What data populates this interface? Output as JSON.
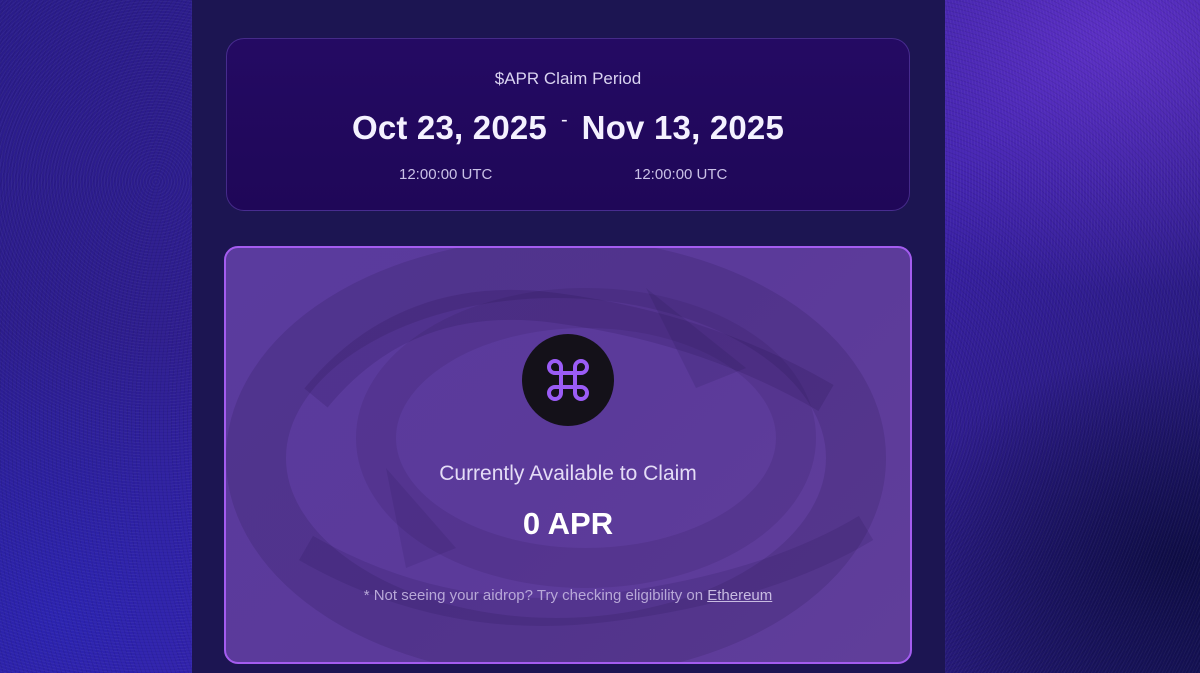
{
  "claim_period": {
    "title": "$APR Claim Period",
    "start_date": "Oct 23, 2025",
    "separator": "-",
    "end_date": "Nov 13, 2025",
    "start_time": "12:00:00 UTC",
    "end_time": "12:00:00 UTC"
  },
  "claim": {
    "logo_icon": "command-icon",
    "available_label": "Currently Available to Claim",
    "amount": "0 APR",
    "note_prefix": "* Not seeing your aidrop? Try checking eligibility on",
    "note_link": "Ethereum"
  },
  "colors": {
    "accent": "#a45cf0",
    "card_dark": "#240a63",
    "claim_card": "#5a3b9e"
  }
}
